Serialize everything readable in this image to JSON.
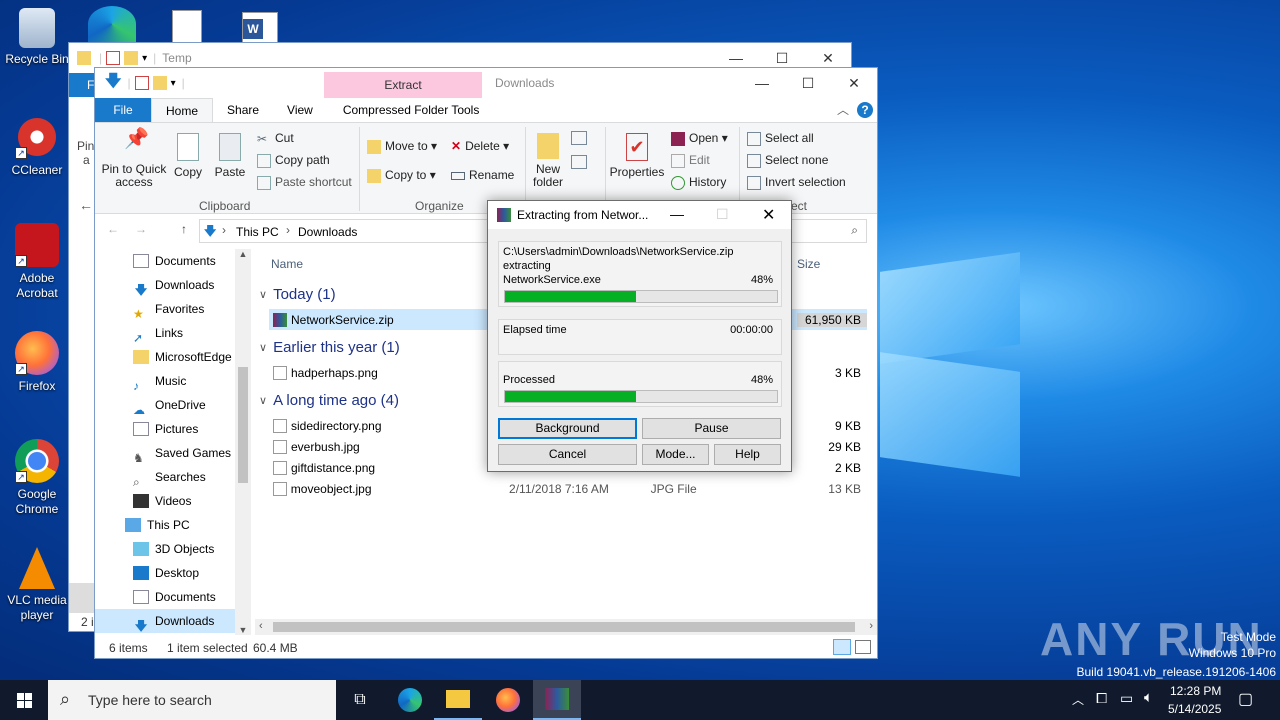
{
  "desktop": {
    "icons": [
      {
        "label": "Recycle Bin"
      },
      {
        "label": "CCleaner"
      },
      {
        "label": "Adobe Acrobat"
      },
      {
        "label": "Firefox"
      },
      {
        "label": "Google Chrome"
      },
      {
        "label": "VLC media player"
      }
    ],
    "watermark": {
      "brand": "ANY RUN",
      "line1": "Test Mode",
      "line2": "Windows 10 Pro",
      "line3": "Build 19041.vb_release.191206-1406"
    }
  },
  "back_window": {
    "title": "Temp",
    "tab_file_fragment": "F",
    "pin_fragment_1": "Pin",
    "pin_fragment_2": "a",
    "status_fragment": "2 i"
  },
  "explorer": {
    "title": "Downloads",
    "context_tab": "Extract",
    "tabs": [
      "File",
      "Home",
      "Share",
      "View",
      "Compressed Folder Tools"
    ],
    "ribbon": {
      "pin_to_quick_access": "Pin to Quick access",
      "copy": "Copy",
      "paste": "Paste",
      "cut": "Cut",
      "copy_path": "Copy path",
      "paste_shortcut": "Paste shortcut",
      "clipboard_group": "Clipboard",
      "move_to": "Move to",
      "copy_to": "Copy to",
      "delete": "Delete",
      "rename": "Rename",
      "organize_group": "Organize",
      "new_folder": "New folder",
      "properties": "Properties",
      "open": "Open",
      "edit": "Edit",
      "history": "History",
      "select_all": "Select all",
      "select_none": "Select none",
      "invert_selection": "Invert selection",
      "select_group_fragment": "ect"
    },
    "breadcrumb": [
      "This PC",
      "Downloads"
    ],
    "nav": [
      {
        "label": "Documents"
      },
      {
        "label": "Downloads"
      },
      {
        "label": "Favorites"
      },
      {
        "label": "Links"
      },
      {
        "label": "MicrosoftEdge"
      },
      {
        "label": "Music"
      },
      {
        "label": "OneDrive"
      },
      {
        "label": "Pictures"
      },
      {
        "label": "Saved Games"
      },
      {
        "label": "Searches"
      },
      {
        "label": "Videos"
      },
      {
        "label": "This PC"
      },
      {
        "label": "3D Objects"
      },
      {
        "label": "Desktop"
      },
      {
        "label": "Documents"
      },
      {
        "label": "Downloads"
      }
    ],
    "columns": {
      "name": "Name",
      "size": "Size"
    },
    "groups": [
      {
        "label": "Today (1)"
      },
      {
        "label": "Earlier this year (1)"
      },
      {
        "label": "A long time ago (4)"
      }
    ],
    "files": [
      {
        "name": "NetworkService.zip",
        "date": "",
        "type": "",
        "size": "61,950 KB"
      },
      {
        "name": "hadperhaps.png",
        "date": "",
        "type": "",
        "size": "3 KB"
      },
      {
        "name": "sidedirectory.png",
        "date": "",
        "type": "",
        "size": "9 KB"
      },
      {
        "name": "everbush.jpg",
        "date": "",
        "type": "",
        "size": "29 KB"
      },
      {
        "name": "giftdistance.png",
        "date": "",
        "type": "",
        "size": "2 KB"
      },
      {
        "name": "moveobject.jpg",
        "date": "2/11/2018 7:16 AM",
        "type": "JPG File",
        "size": "13 KB"
      }
    ],
    "status": {
      "items": "6 items",
      "selected": "1 item selected",
      "size": "60.4 MB"
    }
  },
  "extract_dialog": {
    "title": "Extracting from Networ...",
    "path": "C:\\Users\\admin\\Downloads\\NetworkService.zip",
    "action": "extracting",
    "current_file": "NetworkService.exe",
    "file_percent_label": "48%",
    "file_progress": 0.48,
    "elapsed_label": "Elapsed time",
    "elapsed_value": "00:00:00",
    "processed_label": "Processed",
    "processed_percent_label": "48%",
    "processed_progress": 0.48,
    "buttons": {
      "background": "Background",
      "pause": "Pause",
      "cancel": "Cancel",
      "mode": "Mode...",
      "help": "Help"
    }
  },
  "taskbar": {
    "search_placeholder": "Type here to search",
    "time": "12:28 PM",
    "date": "5/14/2025"
  }
}
